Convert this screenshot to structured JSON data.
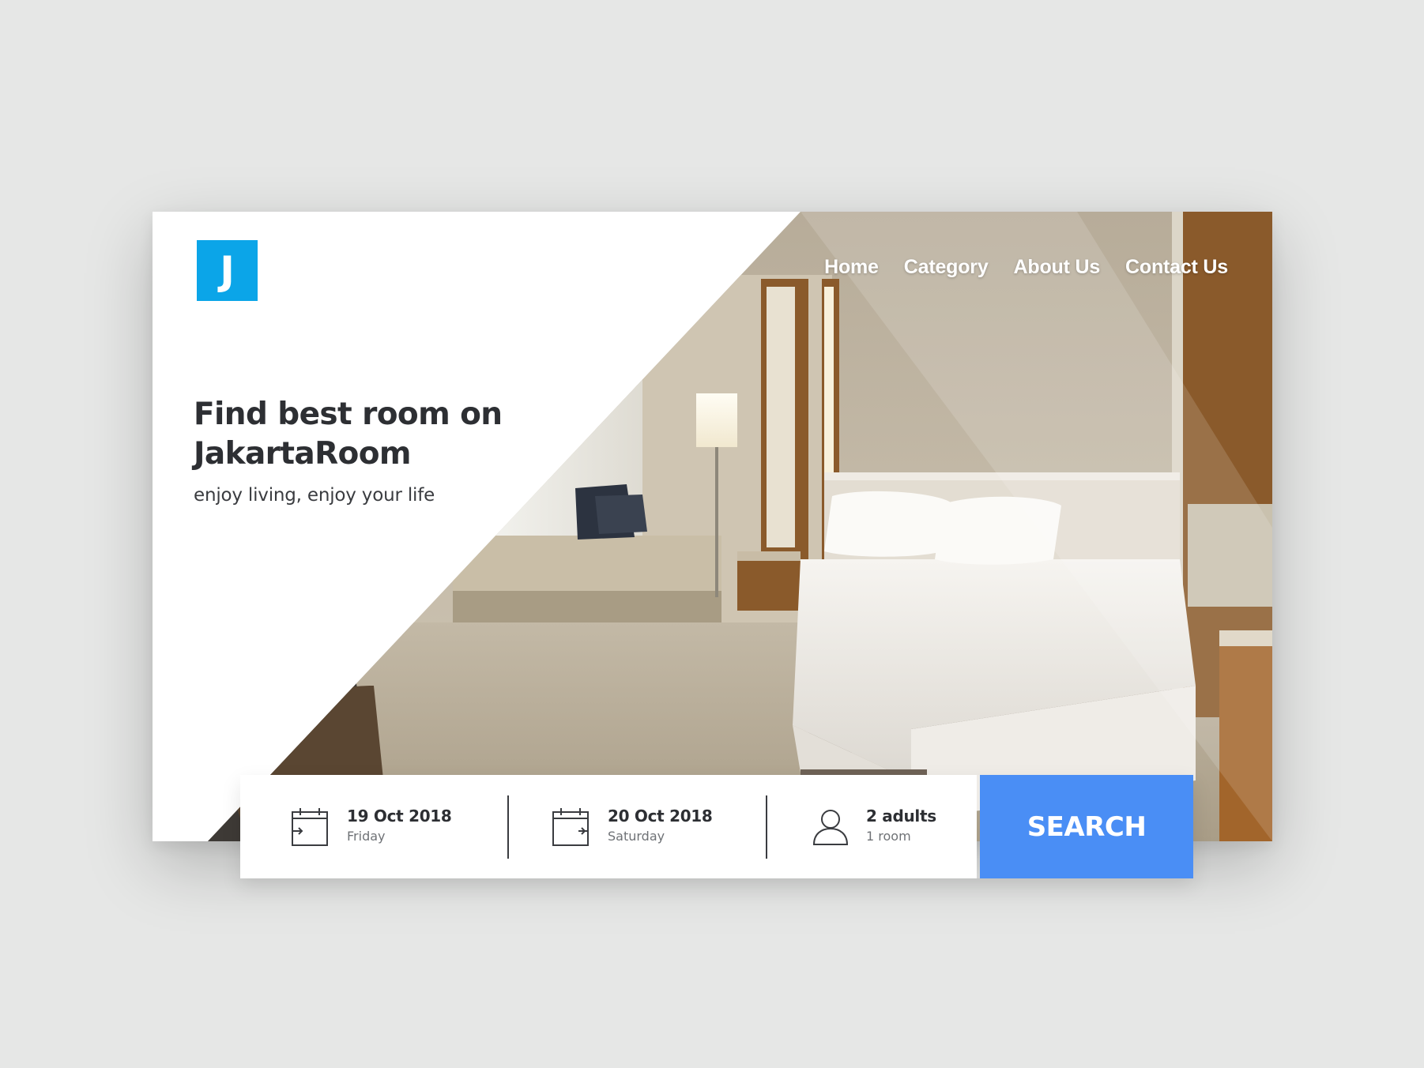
{
  "brand": {
    "logo_letter": "J",
    "accent_color": "#0ba5e8"
  },
  "nav": {
    "items": [
      {
        "label": "Home"
      },
      {
        "label": "Category"
      },
      {
        "label": "About Us"
      },
      {
        "label": "Contact Us"
      }
    ]
  },
  "hero": {
    "title": "Find best room on JakartaRoom",
    "subtitle": "enjoy living, enjoy your life",
    "image": "hotel-bedroom-photo"
  },
  "booking": {
    "checkin": {
      "icon": "calendar-checkin-icon",
      "date": "19 Oct 2018",
      "day": "Friday"
    },
    "checkout": {
      "icon": "calendar-checkout-icon",
      "date": "20 Oct 2018",
      "day": "Saturday"
    },
    "guests": {
      "icon": "person-icon",
      "adults": "2 adults",
      "rooms": "1 room"
    },
    "search_label": "SEARCH",
    "search_color": "#4a8ef5"
  }
}
